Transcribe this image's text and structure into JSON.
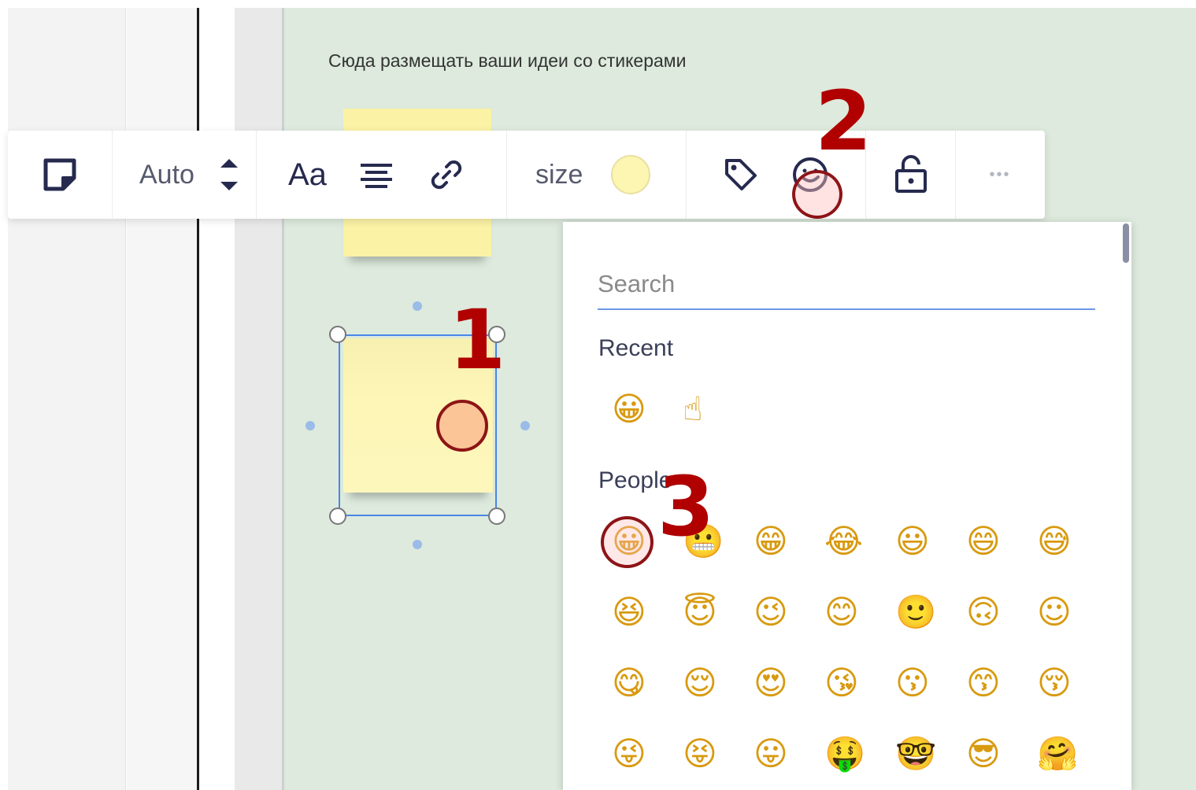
{
  "board": {
    "caption": "Сюда размещать ваши идеи со стикерами"
  },
  "toolbar": {
    "sticker_icon": "sticky-note-icon",
    "font_size_value": "Auto",
    "text_format_label": "Aa",
    "size_label": "size",
    "sticker_color": "#fdf6b2",
    "more_label": "•••"
  },
  "markers": {
    "m1": "1",
    "m2": "2",
    "m3": "3"
  },
  "emoji_panel": {
    "search_placeholder": "Search",
    "recent_title": "Recent",
    "recent": [
      "😀",
      "☝"
    ],
    "people_title": "People",
    "people_rows": [
      [
        "😀",
        "😬",
        "😁",
        "😂",
        "😃",
        "😄",
        "😅"
      ],
      [
        "😆",
        "😇",
        "😉",
        "😊",
        "🙂",
        "🙃",
        "☺"
      ],
      [
        "😋",
        "😌",
        "😍",
        "😘",
        "😗",
        "😙",
        "😚"
      ],
      [
        "😜",
        "😝",
        "😛",
        "🤑",
        "🤓",
        "😎",
        "🤗"
      ]
    ]
  }
}
